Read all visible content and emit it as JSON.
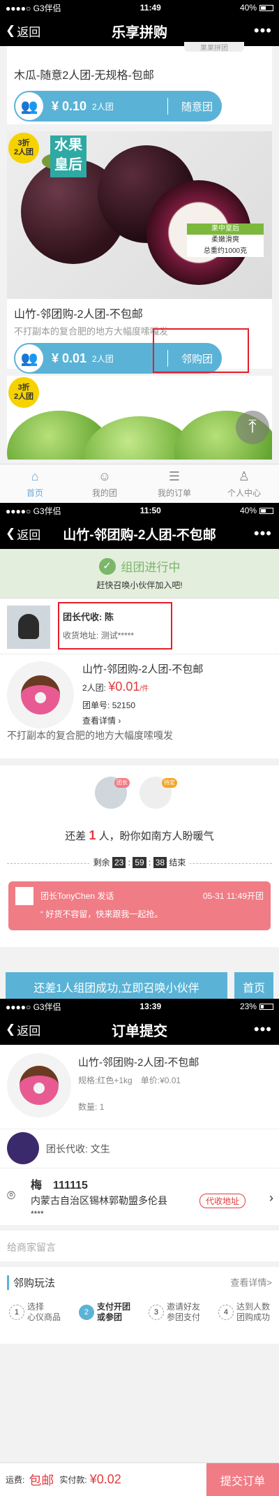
{
  "screen1": {
    "status": {
      "carrier": "●●●●○ G3伴侣",
      "wifi": "wifi-icon",
      "time": "11:49",
      "battery": "40%"
    },
    "nav": {
      "back": "返回",
      "title": "乐享拼购",
      "more": "•••"
    },
    "top_tag": "果果拼团",
    "item1": {
      "name": "木瓜-随意2人团-无规格-包邮",
      "price": "¥ 0.10",
      "count": "2人团",
      "action": "随意团"
    },
    "item2": {
      "badge_discount": "3折",
      "badge_group": "2人团",
      "banner_a": "水果",
      "banner_b": "皇后",
      "tag1": "果中皇后",
      "tag2": "柔嫩滑爽",
      "tag3": "总重约1000克",
      "name": "山竹-邻团购-2人团-不包邮",
      "desc": "不打副本的复合肥的地方大幅度嗦嘎发",
      "price": "¥ 0.01",
      "count": "2人团",
      "action": "邻购团"
    },
    "item3": {
      "badge_discount": "3折",
      "badge_group": "2人团"
    },
    "tabs": [
      "首页",
      "我的团",
      "我的订单",
      "个人中心"
    ]
  },
  "screen2": {
    "status": {
      "carrier": "●●●●○ G3伴侣",
      "time": "11:50",
      "battery": "40%"
    },
    "nav": {
      "back": "返回",
      "title": "山竹-邻团购-2人团-不包邮",
      "more": "•••"
    },
    "progress": {
      "title": "组团进行中",
      "sub": "赶快召唤小伙伴加入吧!"
    },
    "leader": {
      "label": "团长代收:",
      "name": "陈",
      "addr_label": "收货地址:",
      "addr": "测试*****"
    },
    "product": {
      "name": "山竹-邻团购-2人团-不包邮",
      "group": "2人团:",
      "price": "¥0.01",
      "unit": "/件",
      "group_no_label": "团单号:",
      "group_no": "52150",
      "detail": "查看详情",
      "desc": "不打副本的复合肥的地方大幅度嗦嘎发"
    },
    "members": {
      "leader_tag": "团长",
      "wait_tag": "待定"
    },
    "remain": {
      "pre": "还差",
      "num": "1",
      "post": "人，盼你如南方人盼暖气"
    },
    "timer": {
      "pre": "剩余",
      "h": "23",
      "m": "59",
      "s": "38",
      "post": "结束"
    },
    "msg": {
      "from": "团长TonyChen 发话",
      "time": "05-31 11:49开团",
      "text": "好货不容留，快来跟我一起抢。"
    },
    "buttons": {
      "invite": "还差1人组团成功,立即召唤小伙伴",
      "home": "首页"
    }
  },
  "screen3": {
    "status": {
      "carrier": "●●●●○ G3伴侣",
      "time": "13:39",
      "battery": "23%"
    },
    "nav": {
      "back": "返回",
      "title": "订单提交",
      "more": "•••"
    },
    "product": {
      "name": "山竹-邻团购-2人团-不包邮",
      "spec_label": "规格:",
      "spec": "红色+1kg",
      "price_label": "单价:",
      "price": "¥0.01",
      "qty_label": "数量:",
      "qty": "1"
    },
    "leader": {
      "label": "团长代收:",
      "name": "文生"
    },
    "address": {
      "name": "梅",
      "phone": "111115",
      "addr": "内蒙古自治区锡林郭勒盟多伦县",
      "addr2": "****",
      "tag": "代收地址"
    },
    "message": "给商家留言",
    "rules": {
      "title": "邻购玩法",
      "detail": "查看详情>",
      "steps": [
        {
          "n": "1",
          "a": "选择",
          "b": "心仪商品"
        },
        {
          "n": "2",
          "a": "支付开团",
          "b": "或参团"
        },
        {
          "n": "3",
          "a": "邀请好友",
          "b": "参团支付"
        },
        {
          "n": "4",
          "a": "达到人数",
          "b": "团购成功"
        }
      ]
    },
    "bottom": {
      "freight_label": "运费:",
      "freight": "包邮",
      "pay_label": "实付款:",
      "pay": "¥0.02",
      "submit": "提交订单"
    }
  },
  "colors": {
    "accent": "#5ab3d6",
    "red": "#e4393c",
    "pink": "#f07c85",
    "green": "#7bb66a"
  }
}
